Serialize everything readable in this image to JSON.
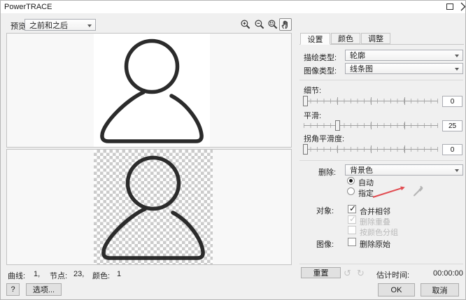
{
  "window": {
    "title": "PowerTRACE"
  },
  "toolbar": {
    "preview_label": "预览:",
    "preview_value": "之前和之后",
    "zoom_icons": [
      "zoom-in",
      "zoom-out",
      "zoom-fit",
      "pan"
    ]
  },
  "tabs": {
    "settings": "设置",
    "color": "颜色",
    "adjust": "调整"
  },
  "settings_panel": {
    "trace_type_label": "描绘类型:",
    "trace_type_value": "轮廓",
    "image_type_label": "图像类型:",
    "image_type_value": "线条图",
    "sliders": [
      {
        "label": "细节:",
        "value": "0",
        "pos": 1
      },
      {
        "label": "平滑:",
        "value": "25",
        "pos": 25
      },
      {
        "label": "拐角平滑度:",
        "value": "0",
        "pos": 1
      }
    ],
    "remove_label": "删除:",
    "remove_value": "背景色",
    "radios": [
      {
        "id": "auto",
        "label": "自动",
        "selected": true
      },
      {
        "id": "specify",
        "label": "指定",
        "selected": false
      }
    ],
    "object_label": "对象:",
    "checkboxes": [
      {
        "id": "merge-adjacent",
        "label": "合并相邻",
        "checked": true,
        "enabled": true
      },
      {
        "id": "remove-overlap",
        "label": "删除重叠",
        "checked": true,
        "enabled": false
      },
      {
        "id": "group-by-color",
        "label": "按颜色分组",
        "checked": false,
        "enabled": false
      }
    ],
    "image_label": "图像:",
    "delete_original": {
      "id": "delete-original",
      "label": "删除原始",
      "checked": false,
      "enabled": true
    }
  },
  "footer": {
    "reset_label": "重置",
    "time_label": "估计时间:",
    "time_value": "00:00:00",
    "ok_label": "OK",
    "cancel_label": "取消"
  },
  "statusbar": {
    "curves_label": "曲线:",
    "curves_value": "1,",
    "nodes_label": "节点:",
    "nodes_value": "23,",
    "colors_label": "颜色:",
    "colors_value": "1"
  },
  "bottom": {
    "help_label": "?",
    "options_label": "选项..."
  },
  "colors": {
    "annotation_red": "#e14b50",
    "trace_stroke": "#2b2b2b",
    "icon_gray": "#3c3c3c"
  }
}
